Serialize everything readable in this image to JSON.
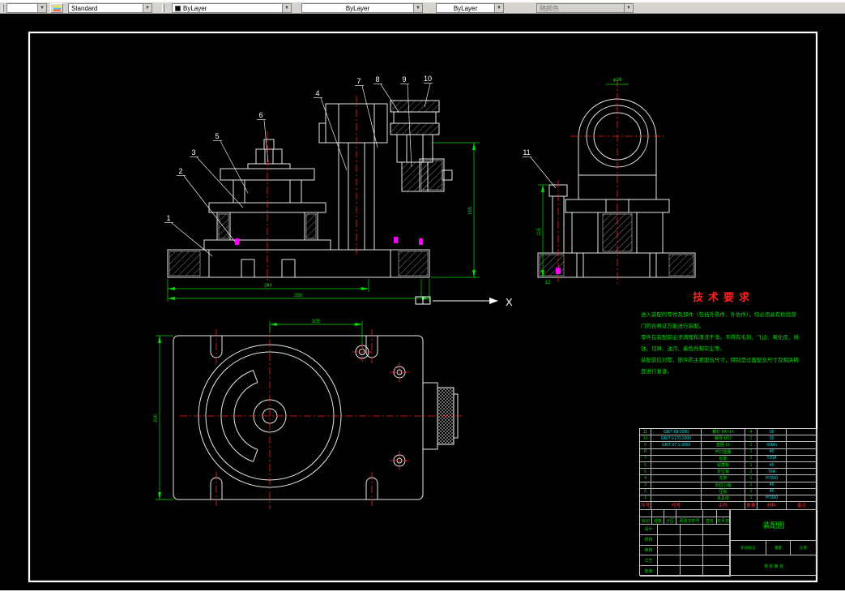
{
  "toolbar": {
    "style_label": "Standard",
    "color_label": "ByLayer",
    "linetype_label": "ByLayer",
    "lineweight_label": "ByLayer",
    "plotstyle_label": "随颜色"
  },
  "drawing_texts": {
    "axis_x": "X",
    "dim_front_w1": "240",
    "dim_front_w2": "350",
    "dim_front_h": "165",
    "dim_side_top": "φ20",
    "dim_side_left": "115",
    "dim_side_bottom": "12",
    "dim_plan_left": "200",
    "dim_plan_top": "105"
  },
  "callouts": [
    "1",
    "2",
    "3",
    "4",
    "5",
    "6",
    "7",
    "8",
    "9",
    "10",
    "11"
  ],
  "tech_requirements": {
    "title": "技术要求",
    "lines": [
      "进入装配的零件及部件（包括外购件、外协件），均必须具有检验部",
      "门的合格证方能进行装配。",
      "零件在装配前必须清理和清洗干净，不得有毛刺、飞边、氧化皮、锈",
      "蚀、切屑、油污、着色剂和灰尘等。",
      "装配前应对零、部件的主要配合尺寸，特别是过盈配合尺寸及相关精",
      "度进行复查。"
    ]
  },
  "bom": {
    "parts_header": [
      "序号",
      "代号",
      "名称",
      "数量",
      "材料",
      "备注"
    ],
    "parts": [
      {
        "no": "11",
        "code": "GB/T 68-2000",
        "name": "螺钉 M6×16",
        "qty": "4",
        "mat": "35",
        "rem": ""
      },
      {
        "no": "10",
        "code": "GB/T 6170-2000",
        "name": "螺母 M12",
        "qty": "1",
        "mat": "35",
        "rem": ""
      },
      {
        "no": "9",
        "code": "GB/T 97.1-2002",
        "name": "垫圈 12",
        "qty": "1",
        "mat": "65Mn",
        "rem": ""
      },
      {
        "no": "8",
        "code": "",
        "name": "开口垫圈",
        "qty": "1",
        "mat": "45",
        "rem": ""
      },
      {
        "no": "7",
        "code": "",
        "name": "钻套",
        "qty": "1",
        "mat": "T10A",
        "rem": ""
      },
      {
        "no": "6",
        "code": "",
        "name": "钻模板",
        "qty": "1",
        "mat": "45",
        "rem": ""
      },
      {
        "no": "5",
        "code": "",
        "name": "定位销",
        "qty": "2",
        "mat": "T8A",
        "rem": ""
      },
      {
        "no": "4",
        "code": "",
        "name": "支架",
        "qty": "1",
        "mat": "HT200",
        "rem": ""
      },
      {
        "no": "3",
        "code": "",
        "name": "定位心轴",
        "qty": "1",
        "mat": "45",
        "rem": ""
      },
      {
        "no": "2",
        "code": "",
        "name": "压板",
        "qty": "1",
        "mat": "45",
        "rem": ""
      },
      {
        "no": "1",
        "code": "",
        "name": "夹具体",
        "qty": "1",
        "mat": "HT200",
        "rem": ""
      }
    ],
    "change_header": [
      "标记",
      "处数",
      "分区",
      "更改文件号",
      "签名",
      "年月日"
    ],
    "sign_rows": [
      "设计",
      "校核",
      "审核",
      "工艺",
      "批准"
    ],
    "stage_label": "阶段标记",
    "weight_label": "重量",
    "scale_label": "比例",
    "sheet_info": "共 张  第 张",
    "drawing_name": "装配图"
  }
}
